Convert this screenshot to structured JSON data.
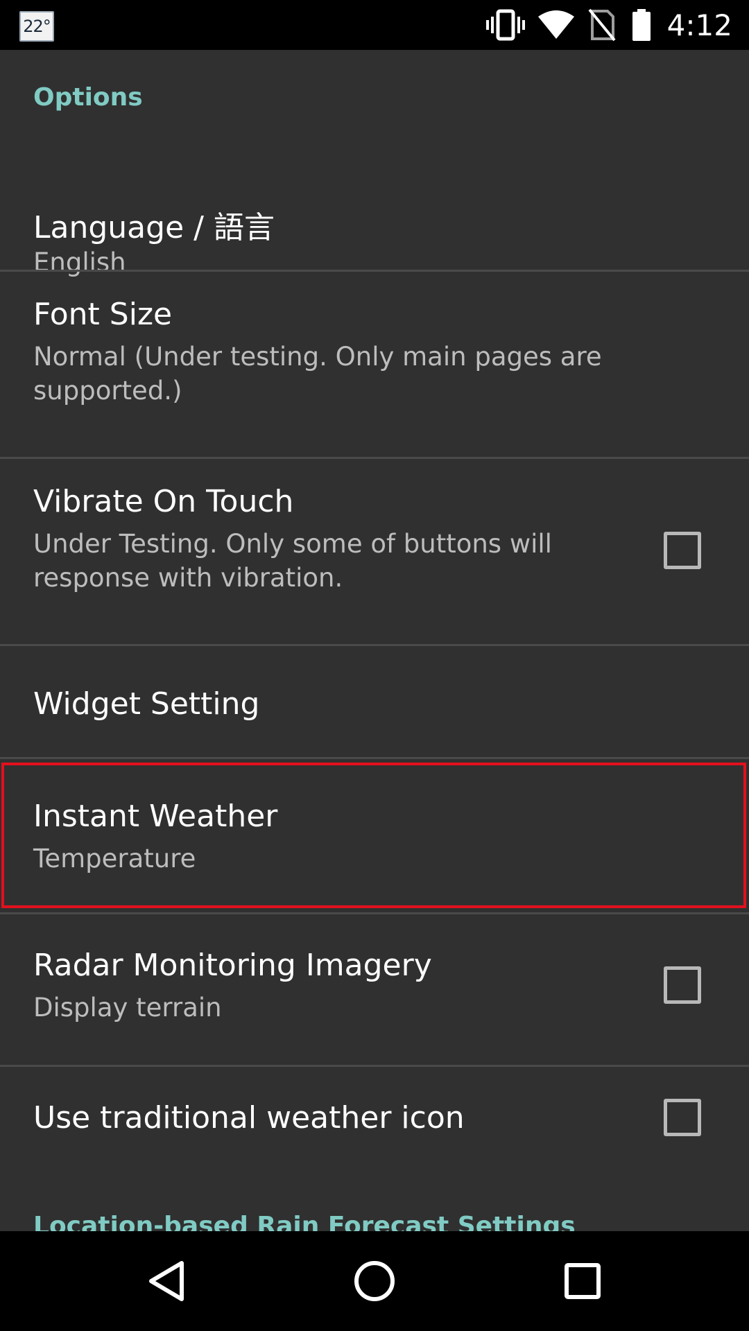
{
  "status_bar": {
    "temperature": "22°",
    "time": "4:12",
    "icons": [
      "vibrate-icon",
      "wifi-icon",
      "no-sim-icon",
      "battery-icon"
    ]
  },
  "sections": {
    "options_header": "Options",
    "next_header": "Location-based Rain Forecast Settings"
  },
  "preferences": [
    {
      "title": "Language / 語言",
      "summary": "English",
      "has_checkbox": false
    },
    {
      "title": "Font Size",
      "summary": "Normal (Under testing. Only main pages are supported.)",
      "has_checkbox": false
    },
    {
      "title": "Vibrate On Touch",
      "summary": "Under Testing. Only some of buttons will response with vibration.",
      "has_checkbox": true,
      "checked": false
    },
    {
      "title": "Widget Setting",
      "summary": "",
      "has_checkbox": false
    },
    {
      "title": "Instant Weather",
      "summary": "Temperature",
      "has_checkbox": false,
      "highlighted": true
    },
    {
      "title": "Radar Monitoring Imagery",
      "summary": "Display terrain",
      "has_checkbox": true,
      "checked": false
    },
    {
      "title": "Use traditional weather icon",
      "summary": "",
      "has_checkbox": true,
      "checked": false
    }
  ],
  "nav_bar": {
    "buttons": [
      "back-icon",
      "home-icon",
      "recents-icon"
    ]
  },
  "colors": {
    "background": "#303030",
    "accent": "#80cbc4",
    "highlight": "#e3101e",
    "title_text": "#ffffff",
    "summary_text": "#bdbdbd"
  }
}
